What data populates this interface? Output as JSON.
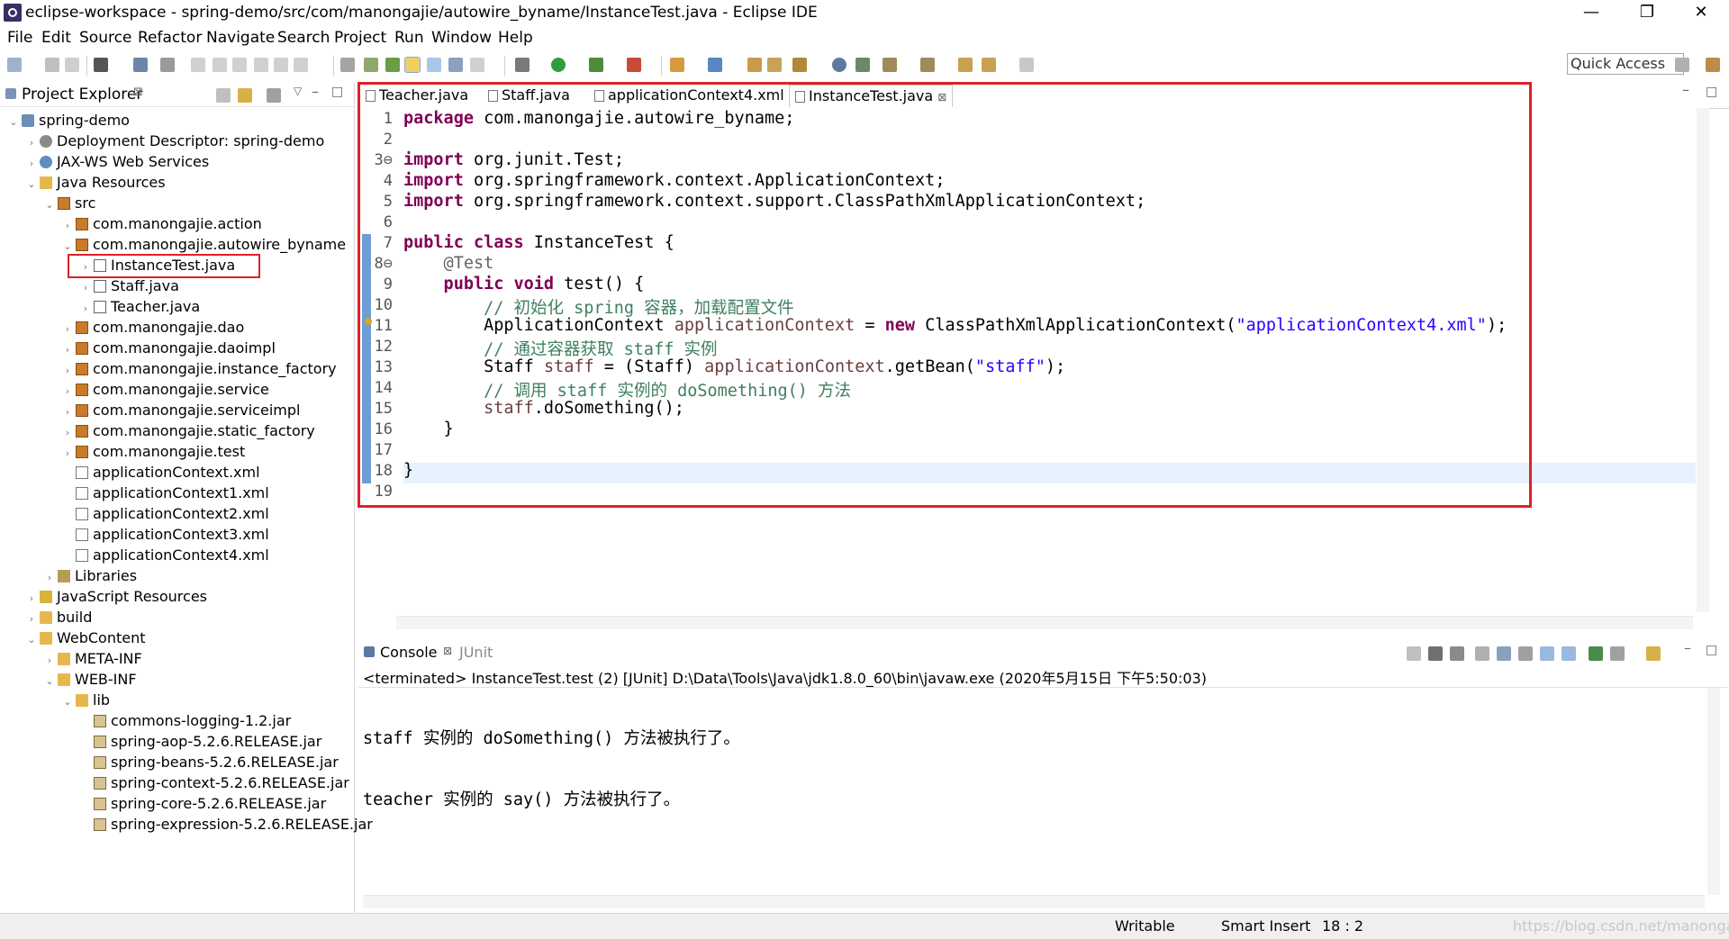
{
  "window": {
    "title": "eclipse-workspace - spring-demo/src/com/manongajie/autowire_byname/InstanceTest.java - Eclipse IDE",
    "min": "—",
    "restore": "❐",
    "close": "✕"
  },
  "menu": [
    "File",
    "Edit",
    "Source",
    "Refactor",
    "Navigate",
    "Search",
    "Project",
    "Run",
    "Window",
    "Help"
  ],
  "toolbar": {
    "quick_access": "Quick Access"
  },
  "explorer": {
    "title": "Project Explorer",
    "close_glyph": "⊠",
    "items": [
      {
        "arrow": "⌄",
        "icon": "project",
        "label": "spring-demo"
      },
      {
        "arrow": "›",
        "icon": "dd",
        "label": "Deployment Descriptor: spring-demo"
      },
      {
        "arrow": "›",
        "icon": "web",
        "label": "JAX-WS Web Services"
      },
      {
        "arrow": "⌄",
        "icon": "folder",
        "label": "Java Resources"
      },
      {
        "arrow": "⌄",
        "icon": "package",
        "label": "src"
      },
      {
        "arrow": "›",
        "icon": "package",
        "label": "com.manongajie.action"
      },
      {
        "arrow": "⌄",
        "icon": "package",
        "label": "com.manongajie.autowire_byname"
      },
      {
        "arrow": "›",
        "icon": "java",
        "label": "InstanceTest.java"
      },
      {
        "arrow": "›",
        "icon": "java",
        "label": "Staff.java"
      },
      {
        "arrow": "›",
        "icon": "java",
        "label": "Teacher.java"
      },
      {
        "arrow": "›",
        "icon": "package",
        "label": "com.manongajie.dao"
      },
      {
        "arrow": "›",
        "icon": "package",
        "label": "com.manongajie.daoimpl"
      },
      {
        "arrow": "›",
        "icon": "package",
        "label": "com.manongajie.instance_factory"
      },
      {
        "arrow": "›",
        "icon": "package",
        "label": "com.manongajie.service"
      },
      {
        "arrow": "›",
        "icon": "package",
        "label": "com.manongajie.serviceimpl"
      },
      {
        "arrow": "›",
        "icon": "package",
        "label": "com.manongajie.static_factory"
      },
      {
        "arrow": "›",
        "icon": "package",
        "label": "com.manongajie.test"
      },
      {
        "arrow": "",
        "icon": "xml",
        "label": "applicationContext.xml"
      },
      {
        "arrow": "",
        "icon": "xml",
        "label": "applicationContext1.xml"
      },
      {
        "arrow": "",
        "icon": "xml",
        "label": "applicationContext2.xml"
      },
      {
        "arrow": "",
        "icon": "xml",
        "label": "applicationContext3.xml"
      },
      {
        "arrow": "",
        "icon": "xml",
        "label": "applicationContext4.xml"
      },
      {
        "arrow": "›",
        "icon": "lib",
        "label": "Libraries"
      },
      {
        "arrow": "›",
        "icon": "js",
        "label": "JavaScript Resources"
      },
      {
        "arrow": "›",
        "icon": "folder",
        "label": "build"
      },
      {
        "arrow": "⌄",
        "icon": "folder",
        "label": "WebContent"
      },
      {
        "arrow": "›",
        "icon": "folder",
        "label": "META-INF"
      },
      {
        "arrow": "⌄",
        "icon": "folder",
        "label": "WEB-INF"
      },
      {
        "arrow": "⌄",
        "icon": "folder",
        "label": "lib"
      },
      {
        "arrow": "",
        "icon": "jar",
        "label": "commons-logging-1.2.jar"
      },
      {
        "arrow": "",
        "icon": "jar",
        "label": "spring-aop-5.2.6.RELEASE.jar"
      },
      {
        "arrow": "",
        "icon": "jar",
        "label": "spring-beans-5.2.6.RELEASE.jar"
      },
      {
        "arrow": "",
        "icon": "jar",
        "label": "spring-context-5.2.6.RELEASE.jar"
      },
      {
        "arrow": "",
        "icon": "jar",
        "label": "spring-core-5.2.6.RELEASE.jar"
      },
      {
        "arrow": "",
        "icon": "jar",
        "label": "spring-expression-5.2.6.RELEASE.jar"
      }
    ]
  },
  "editor": {
    "tabs": [
      {
        "label": "Teacher.java",
        "active": false
      },
      {
        "label": "Staff.java",
        "active": false
      },
      {
        "label": "applicationContext4.xml",
        "active": false
      },
      {
        "label": "InstanceTest.java",
        "active": true
      }
    ],
    "tab_close": "⊠",
    "line_numbers": [
      "1",
      "2",
      "3⊖",
      "4",
      "5",
      "6",
      "7",
      "8⊖",
      "9",
      "10",
      "11",
      "12",
      "13",
      "14",
      "15",
      "16",
      "17",
      "18",
      "19"
    ],
    "lines": [
      [
        {
          "t": "package ",
          "c": "kw"
        },
        {
          "t": "com.manongajie.autowire_byname;",
          "c": ""
        }
      ],
      [],
      [
        {
          "t": "import ",
          "c": "kw"
        },
        {
          "t": "org.junit.Test;",
          "c": ""
        }
      ],
      [
        {
          "t": "import ",
          "c": "kw"
        },
        {
          "t": "org.springframework.context.ApplicationContext;",
          "c": ""
        }
      ],
      [
        {
          "t": "import ",
          "c": "kw"
        },
        {
          "t": "org.springframework.context.support.ClassPathXmlApplicationContext;",
          "c": ""
        }
      ],
      [],
      [
        {
          "t": "public class ",
          "c": "kw"
        },
        {
          "t": "InstanceTest {",
          "c": ""
        }
      ],
      [
        {
          "t": "    @Test",
          "c": "ann"
        }
      ],
      [
        {
          "t": "    public void ",
          "c": "kw"
        },
        {
          "t": "test() {",
          "c": ""
        }
      ],
      [
        {
          "t": "        // 初始化 spring 容器，加载配置文件",
          "c": "cmt"
        }
      ],
      [
        {
          "t": "        ApplicationContext ",
          "c": ""
        },
        {
          "t": "applicationContext",
          "c": "field"
        },
        {
          "t": " = ",
          "c": ""
        },
        {
          "t": "new ",
          "c": "kw"
        },
        {
          "t": "ClassPathXmlApplicationContext(",
          "c": ""
        },
        {
          "t": "\"applicationContext4.xml\"",
          "c": "str"
        },
        {
          "t": ");",
          "c": ""
        }
      ],
      [
        {
          "t": "        // 通过容器获取 staff 实例",
          "c": "cmt"
        }
      ],
      [
        {
          "t": "        Staff ",
          "c": ""
        },
        {
          "t": "staff",
          "c": "field"
        },
        {
          "t": " = (Staff) ",
          "c": ""
        },
        {
          "t": "applicationContext",
          "c": "field"
        },
        {
          "t": ".getBean(",
          "c": ""
        },
        {
          "t": "\"staff\"",
          "c": "str"
        },
        {
          "t": ");",
          "c": ""
        }
      ],
      [
        {
          "t": "        // 调用 staff 实例的 doSomething() 方法",
          "c": "cmt"
        }
      ],
      [
        {
          "t": "        staff",
          "c": "field"
        },
        {
          "t": ".doSomething();",
          "c": ""
        }
      ],
      [
        {
          "t": "    }",
          "c": ""
        }
      ],
      [],
      [
        {
          "t": "}",
          "c": ""
        }
      ],
      []
    ]
  },
  "console": {
    "tab_label": "Console",
    "tab_junit": "JUnit",
    "status": "<terminated> InstanceTest.test (2) [JUnit] D:\\Data\\Tools\\Java\\jdk1.8.0_60\\bin\\javaw.exe (2020年5月15日 下午5:50:03)",
    "output": [
      "staff 实例的 doSomething() 方法被执行了。",
      "teacher 实例的 say() 方法被执行了。"
    ]
  },
  "statusbar": {
    "writable": "Writable",
    "insert_mode": "Smart Insert",
    "position": "18 : 2",
    "watermark": "https://blog.csdn.net/manongajie"
  },
  "colors": {
    "highlight_box": "#e0202a",
    "keyword": "#7f0055",
    "string": "#2a00ff",
    "comment": "#3f7f5f",
    "field": "#6a3e3e"
  }
}
